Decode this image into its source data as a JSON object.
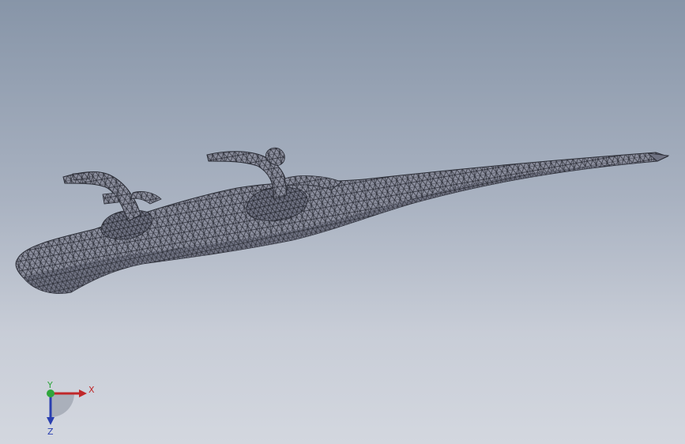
{
  "viewport": {
    "background_top": "#8795a8",
    "background_bottom": "#d3d7df",
    "model": {
      "render_style": "shaded with mesh edges",
      "fill_color": "#8a8d9c",
      "edge_color": "#2a2c35",
      "icon": "meshed-part"
    }
  },
  "triad": {
    "x_label": "X",
    "y_label": "Y",
    "z_label": "Z",
    "x_color": "#c0282a",
    "y_color": "#2fa63c",
    "z_color": "#2a3fb0"
  }
}
